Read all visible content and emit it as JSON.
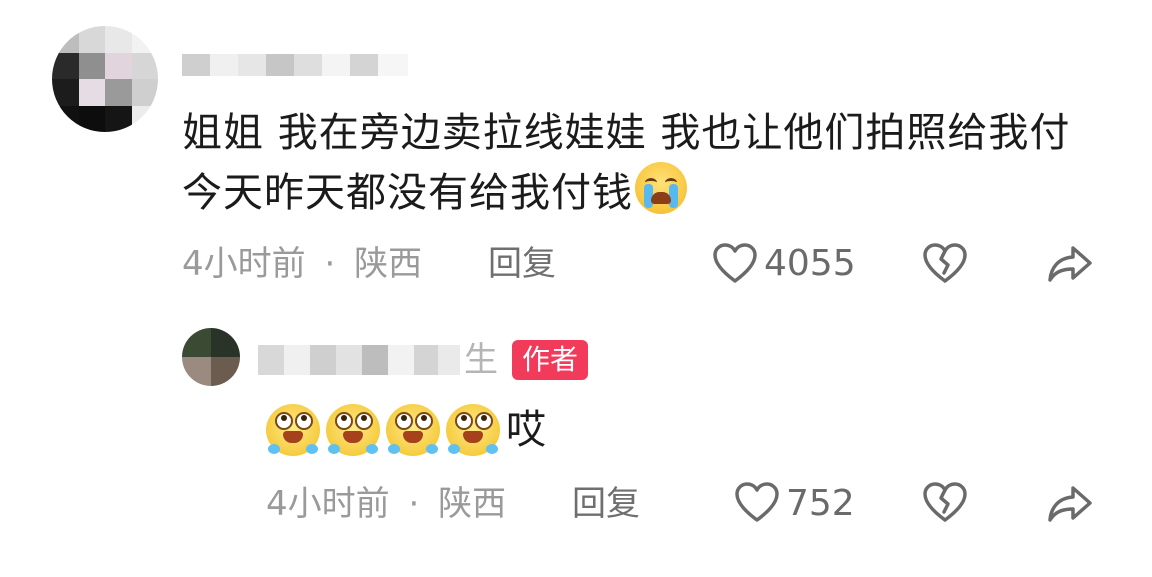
{
  "comment": {
    "text": "姐姐 我在旁边卖拉线娃娃 我也让他们拍照给我付 今天昨天都没有给我付钱",
    "emoji": "crying-face",
    "time": "4小时前",
    "dot": "·",
    "location": "陕西",
    "reply_label": "回复",
    "like_count": "4055"
  },
  "reply": {
    "name_visible_char": "生",
    "author_badge": "作者",
    "emoji": "sweat-smile-face",
    "emoji_count": 4,
    "text": "哎",
    "time": "4小时前",
    "dot": "·",
    "location": "陕西",
    "reply_label": "回复",
    "like_count": "752"
  },
  "colors": {
    "badge": "#f23a5b",
    "meta_text": "#9a9a9a",
    "icon": "#6a6a6a"
  }
}
